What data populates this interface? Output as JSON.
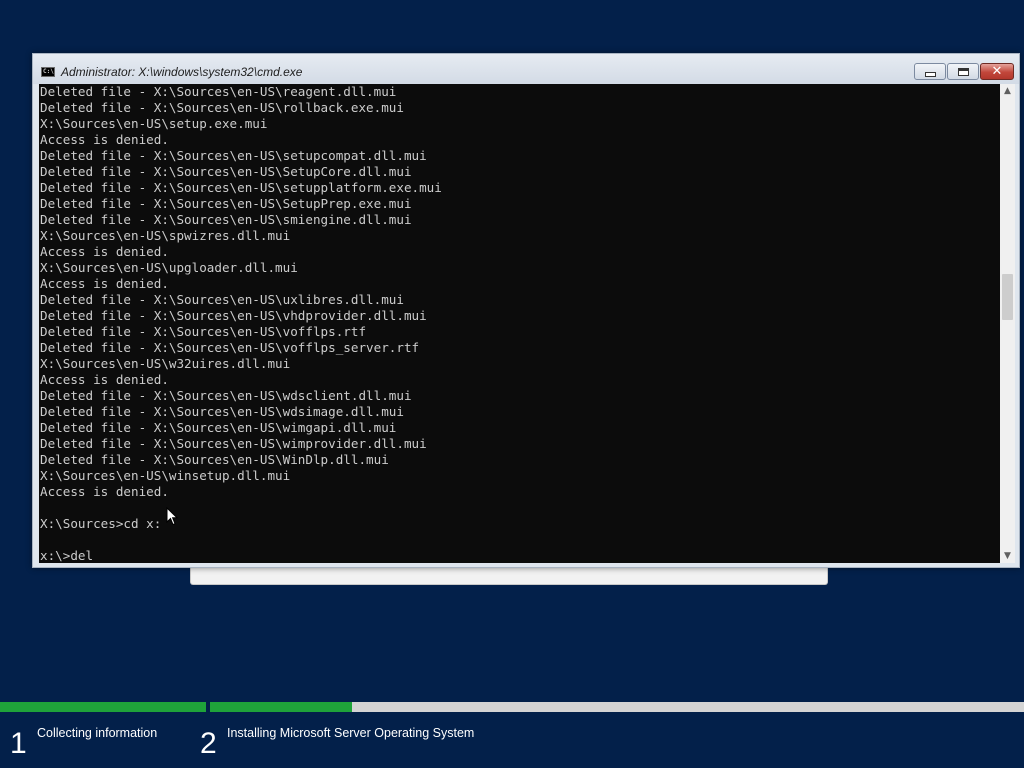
{
  "window": {
    "title": "Administrator: X:\\windows\\system32\\cmd.exe",
    "icon": "cmd-icon",
    "controls": {
      "minimize": "minimize-icon",
      "maximize": "maximize-icon",
      "close": "✕"
    }
  },
  "console": {
    "lines": [
      "Deleted file - X:\\Sources\\en-US\\reagent.dll.mui",
      "Deleted file - X:\\Sources\\en-US\\rollback.exe.mui",
      "X:\\Sources\\en-US\\setup.exe.mui",
      "Access is denied.",
      "Deleted file - X:\\Sources\\en-US\\setupcompat.dll.mui",
      "Deleted file - X:\\Sources\\en-US\\SetupCore.dll.mui",
      "Deleted file - X:\\Sources\\en-US\\setupplatform.exe.mui",
      "Deleted file - X:\\Sources\\en-US\\SetupPrep.exe.mui",
      "Deleted file - X:\\Sources\\en-US\\smiengine.dll.mui",
      "X:\\Sources\\en-US\\spwizres.dll.mui",
      "Access is denied.",
      "X:\\Sources\\en-US\\upgloader.dll.mui",
      "Access is denied.",
      "Deleted file - X:\\Sources\\en-US\\uxlibres.dll.mui",
      "Deleted file - X:\\Sources\\en-US\\vhdprovider.dll.mui",
      "Deleted file - X:\\Sources\\en-US\\vofflps.rtf",
      "Deleted file - X:\\Sources\\en-US\\vofflps_server.rtf",
      "X:\\Sources\\en-US\\w32uires.dll.mui",
      "Access is denied.",
      "Deleted file - X:\\Sources\\en-US\\wdsclient.dll.mui",
      "Deleted file - X:\\Sources\\en-US\\wdsimage.dll.mui",
      "Deleted file - X:\\Sources\\en-US\\wimgapi.dll.mui",
      "Deleted file - X:\\Sources\\en-US\\wimprovider.dll.mui",
      "Deleted file - X:\\Sources\\en-US\\WinDlp.dll.mui",
      "X:\\Sources\\en-US\\winsetup.dll.mui",
      "Access is denied.",
      "",
      "X:\\Sources>cd x:",
      "",
      "x:\\>del"
    ],
    "text_color": "#cccccc",
    "background": "#0c0c0c"
  },
  "scrollbar": {
    "up_arrow": "▲",
    "down_arrow": "▼",
    "position": 0.4
  },
  "setup_progress": {
    "steps": [
      {
        "number": "1",
        "label": "Collecting information",
        "progress": 1.0
      },
      {
        "number": "2",
        "label": "Installing Microsoft Server Operating System",
        "progress": 0.174
      }
    ],
    "fill_color": "#1fa33a"
  },
  "colors": {
    "desktop_background": "#03204a",
    "close_button": "#c2473b"
  }
}
